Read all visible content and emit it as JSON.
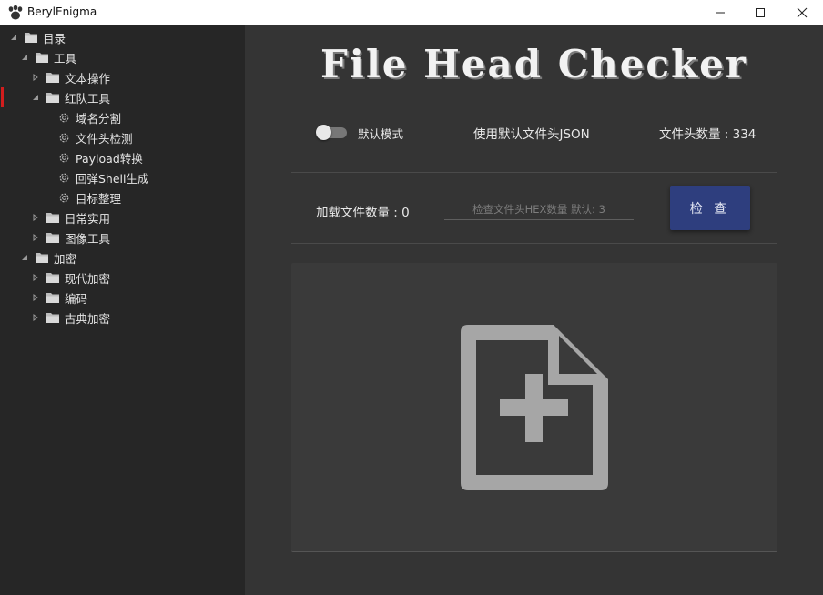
{
  "window": {
    "title": "BerylEnigma",
    "icon": "paw-icon"
  },
  "sidebar": {
    "root": {
      "label": "目录",
      "children": [
        {
          "label": "工具",
          "items": [
            {
              "label": "文本操作",
              "expanded": false
            },
            {
              "label": "红队工具",
              "expanded": true,
              "selected": true,
              "items": [
                "域名分割",
                "文件头检测",
                "Payload转换",
                "回弹Shell生成",
                "目标整理"
              ]
            },
            {
              "label": "日常实用",
              "expanded": false
            },
            {
              "label": "图像工具",
              "expanded": false
            }
          ]
        },
        {
          "label": "加密",
          "items": [
            {
              "label": "现代加密",
              "expanded": false
            },
            {
              "label": "编码",
              "expanded": false
            },
            {
              "label": "古典加密",
              "expanded": false
            }
          ]
        }
      ]
    }
  },
  "main": {
    "heading": "File Head Checker",
    "toggle": {
      "label": "默认模式",
      "on": false
    },
    "json_label": "使用默认文件头JSON",
    "count_label": "文件头数量 : 334",
    "loaded_label": "加载文件数量 : 0",
    "hex_input": {
      "value": "",
      "placeholder": "检查文件头HEX数量 默认: 3"
    },
    "check_button": "检 查",
    "drop_zone_icon": "file-add-icon"
  },
  "colors": {
    "accent_button": "#2e3e7e",
    "selection_marker": "#d21d1d",
    "sidebar_bg": "#262626",
    "main_bg": "#343434",
    "drop_zone_bg": "#3a3a3a"
  }
}
